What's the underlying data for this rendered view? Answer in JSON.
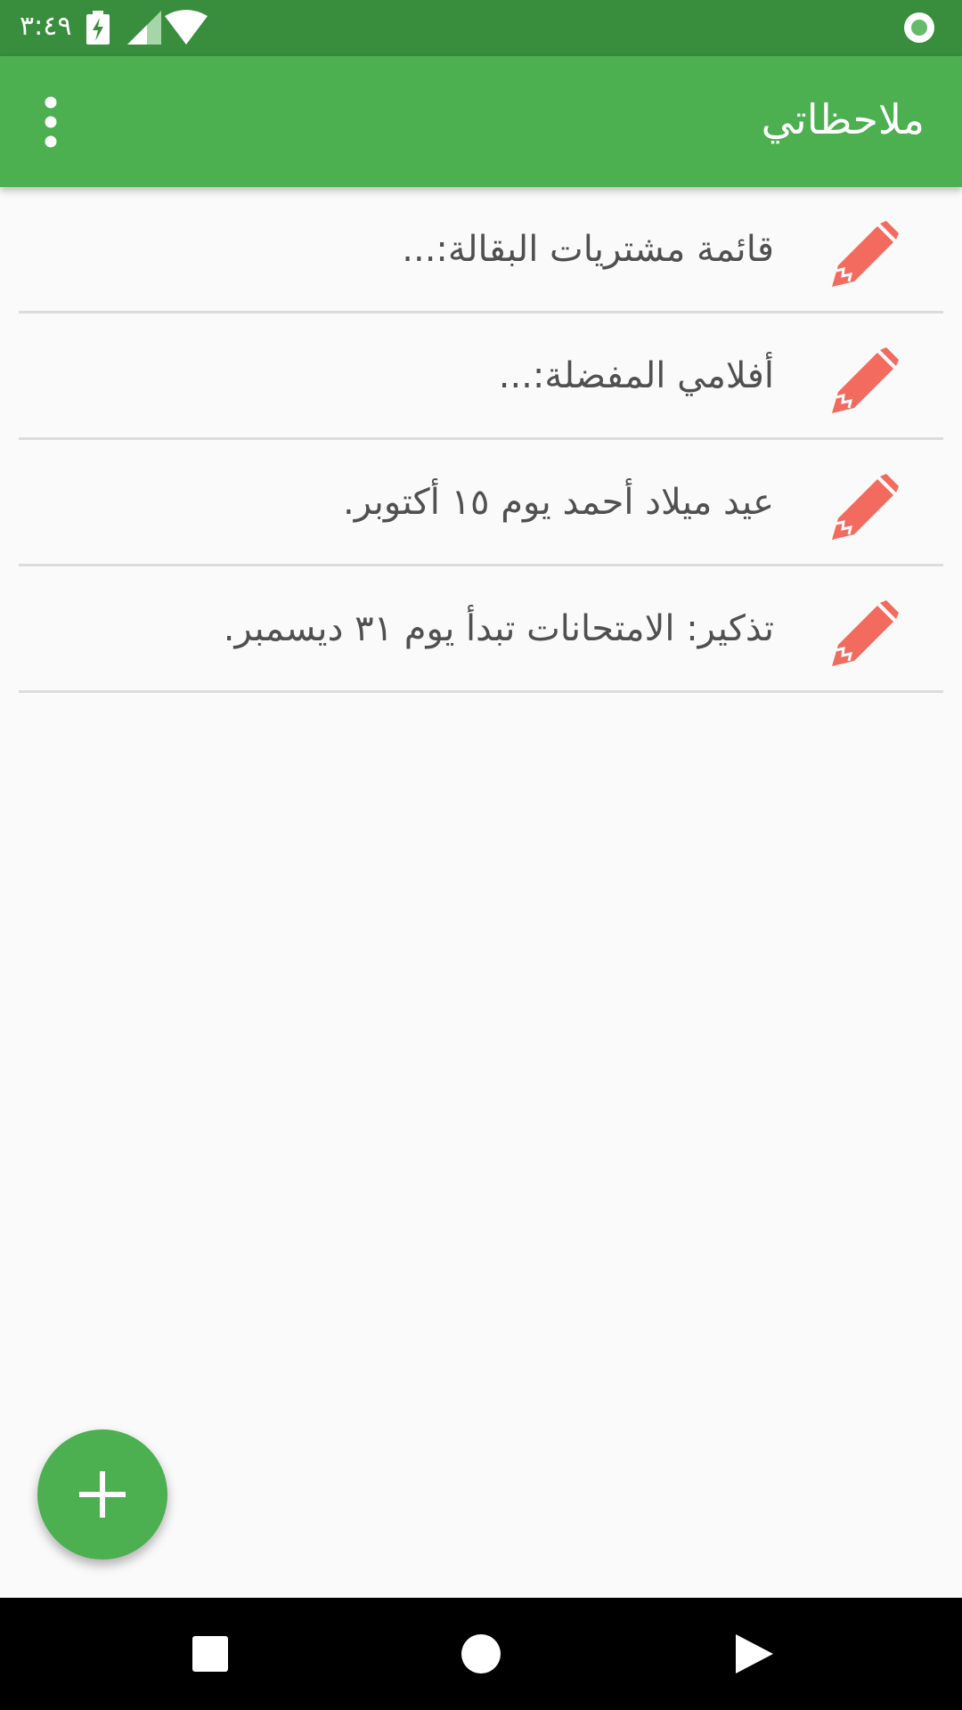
{
  "status_bar": {
    "time": "٣:٤٩",
    "icons": [
      "battery-charging-icon",
      "cell-signal-icon",
      "wifi-icon",
      "record-dot-icon"
    ]
  },
  "app_bar": {
    "title": "ملاحظاتي",
    "menu_icon": "more-vert-icon"
  },
  "notes": [
    {
      "text": "قائمة مشتريات البقالة:...",
      "icon": "pencil-icon"
    },
    {
      "text": "أفلامي المفضلة:...",
      "icon": "pencil-icon"
    },
    {
      "text": "عيد ميلاد أحمد يوم ١٥ أكتوبر.",
      "icon": "pencil-icon"
    },
    {
      "text": "تذكير: الامتحانات تبدأ يوم ٣١ ديسمبر.",
      "icon": "pencil-icon"
    }
  ],
  "fab": {
    "icon": "plus-icon"
  },
  "nav_bar": {
    "icons": [
      "recents-square-icon",
      "home-circle-icon",
      "back-triangle-icon"
    ]
  },
  "colors": {
    "status_bar": "#388e3c",
    "app_bar": "#4caf50",
    "accent_pencil": "#f26b5e",
    "background": "#fafafa",
    "note_text": "#505050",
    "divider": "#dcdcdc"
  }
}
